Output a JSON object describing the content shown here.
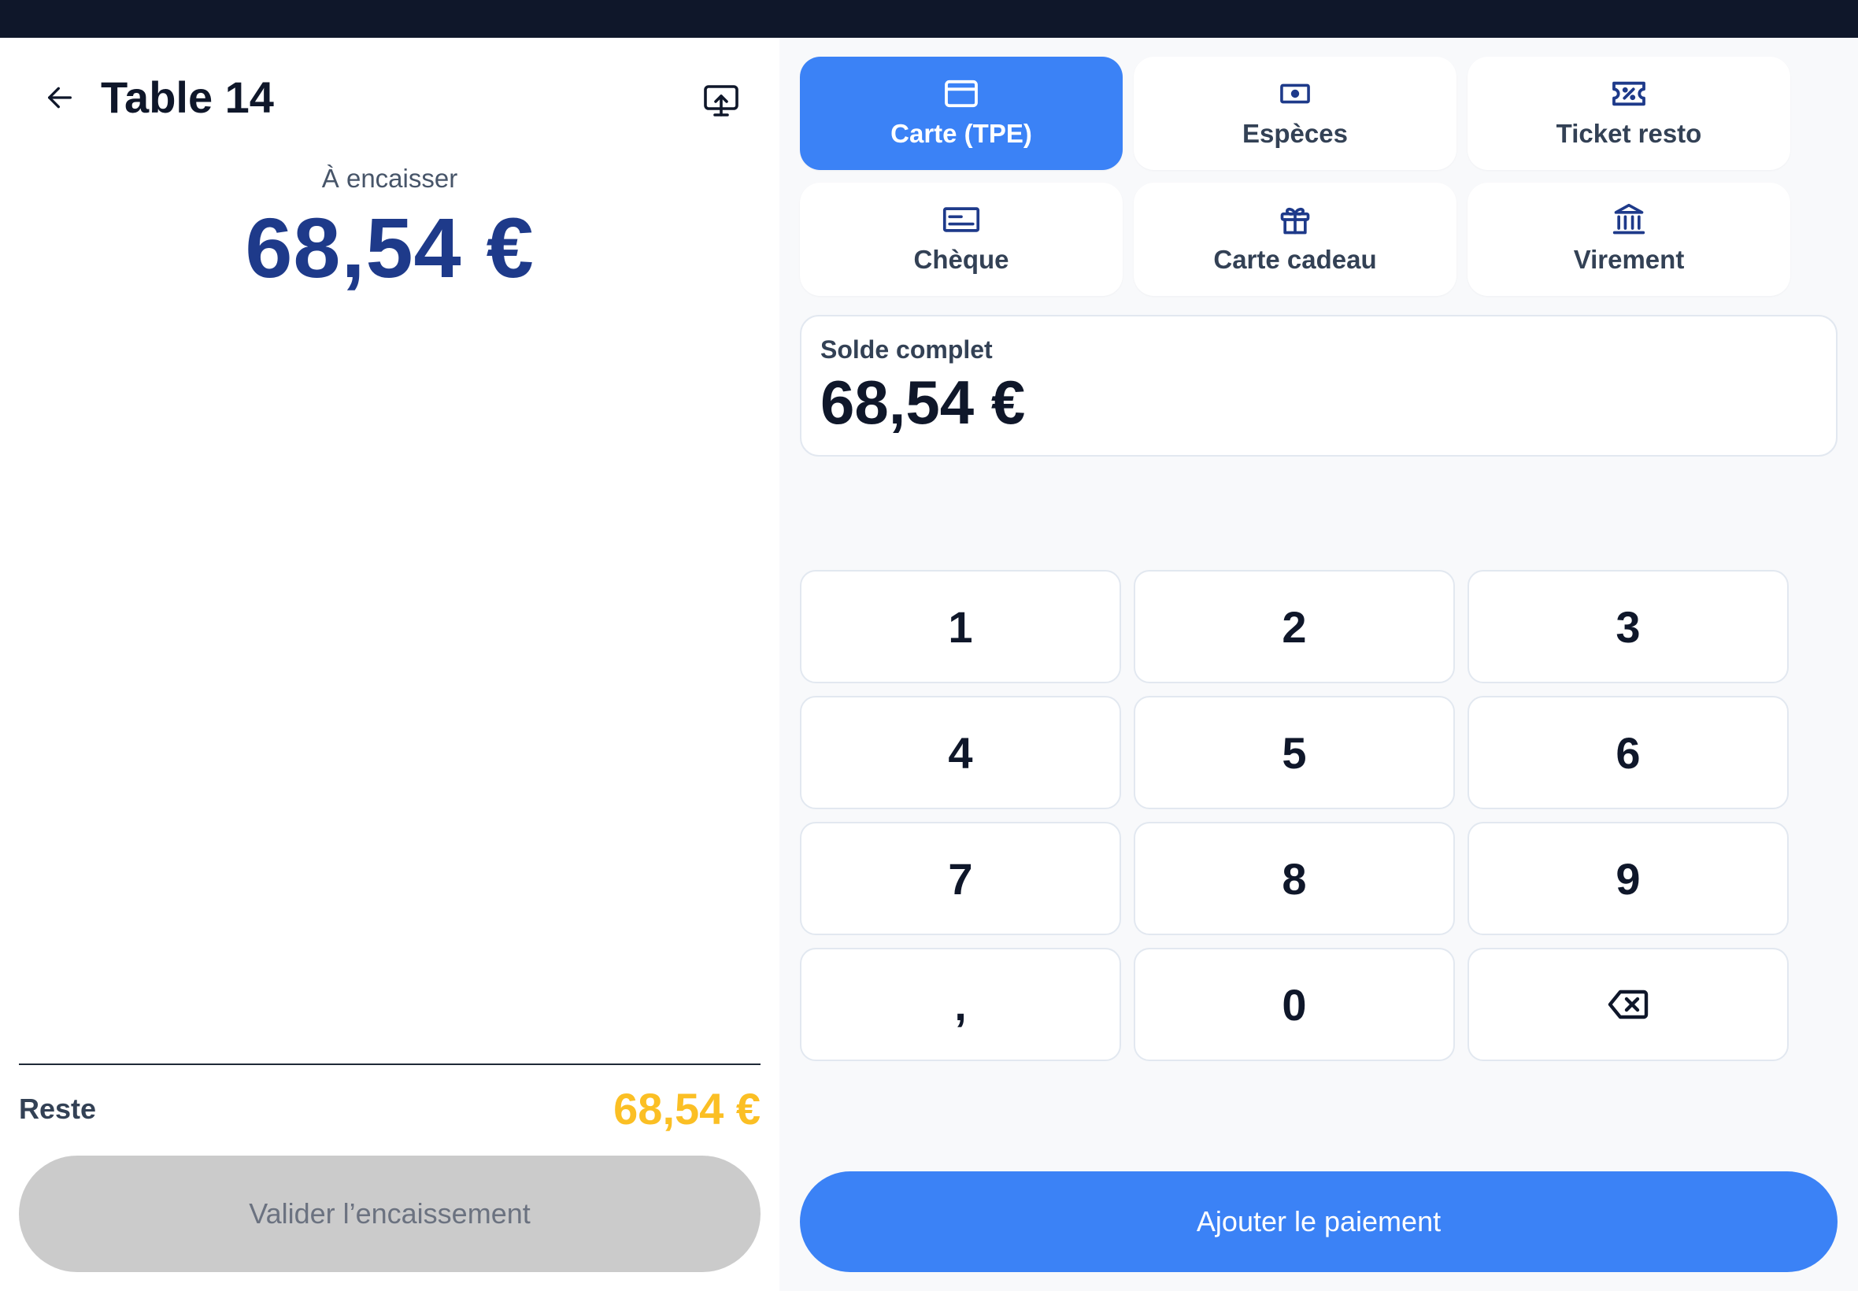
{
  "header": {
    "title": "Table 14",
    "back_icon": "arrow-left-icon",
    "display_icon": "screen-share-icon"
  },
  "summary": {
    "due_label": "À encaisser",
    "due_amount": "68,54 €"
  },
  "footer": {
    "remaining_label": "Reste",
    "remaining_amount": "68,54 €",
    "validate_label": "Valider l’encaissement"
  },
  "payment_methods": [
    {
      "label": "Carte (TPE)",
      "icon": "credit-card-icon",
      "selected": true
    },
    {
      "label": "Espèces",
      "icon": "banknote-icon",
      "selected": false
    },
    {
      "label": "Ticket resto",
      "icon": "ticket-percent-icon",
      "selected": false
    },
    {
      "label": "Chèque",
      "icon": "cheque-icon",
      "selected": false
    },
    {
      "label": "Carte cadeau",
      "icon": "gift-icon",
      "selected": false
    },
    {
      "label": "Virement",
      "icon": "bank-icon",
      "selected": false
    }
  ],
  "balance": {
    "label": "Solde complet",
    "amount": "68,54 €"
  },
  "keypad": {
    "keys": [
      "1",
      "2",
      "3",
      "4",
      "5",
      "6",
      "7",
      "8",
      "9",
      ",",
      "0"
    ],
    "delete_icon": "backspace-icon"
  },
  "add_payment_label": "Ajouter le paiement",
  "colors": {
    "accent": "#3b82f6",
    "amount_blue": "#1e3a8a",
    "remaining_yellow": "#fbbf24",
    "icon_navy": "#1e3a8a",
    "disabled_gray": "#cbcbcb"
  }
}
